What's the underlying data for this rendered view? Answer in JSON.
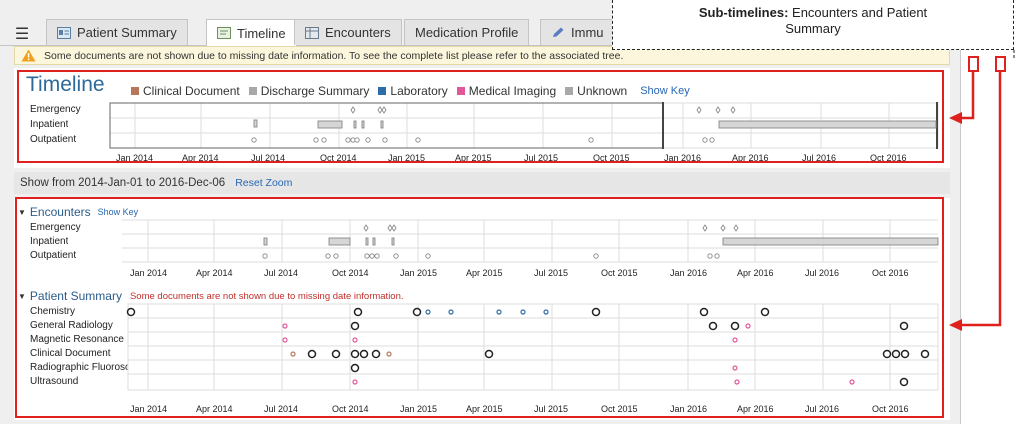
{
  "tabs": [
    {
      "label": "Patient Summary",
      "icon": "patient-summary-icon"
    },
    {
      "label": "Timeline",
      "icon": "timeline-icon",
      "active": true
    },
    {
      "label": "Encounters",
      "icon": "encounters-icon"
    },
    {
      "label": "Medication Profile",
      "icon": ""
    },
    {
      "label": "Immu",
      "icon": "pencil-icon"
    }
  ],
  "menu_icon": "hamburger-menu-icon",
  "warning": {
    "icon": "warning-triangle-icon",
    "text": "Some documents are not shown due to missing date information. To see the complete list please refer to the associated tree."
  },
  "callout": {
    "bold": "Sub-timelines:",
    "text": " Encounters and Patient",
    "text2": "Summary"
  },
  "timeline": {
    "title": "Timeline",
    "legend": [
      {
        "label": "Clinical Document",
        "color": "#b5765a"
      },
      {
        "label": "Discharge Summary",
        "color": "#a8a8a8"
      },
      {
        "label": "Laboratory",
        "color": "#2d6ca6"
      },
      {
        "label": "Medical Imaging",
        "color": "#e0579a"
      },
      {
        "label": "Unknown",
        "color": "#a8a8a8"
      }
    ],
    "show_key": "Show Key",
    "rows": [
      "Emergency",
      "Inpatient",
      "Outpatient"
    ],
    "axis": [
      "Jan 2014",
      "Apr 2014",
      "Jul 2014",
      "Oct 2014",
      "Jan 2015",
      "Apr 2015",
      "Jul 2015",
      "Oct 2015",
      "Jan 2016",
      "Apr 2016",
      "Jul 2016",
      "Oct 2016"
    ]
  },
  "zoom": {
    "text": "Show from 2014-Jan-01 to 2016-Dec-06",
    "reset": "Reset Zoom"
  },
  "encounters": {
    "title": "Encounters",
    "show_key": "Show Key",
    "rows": [
      "Emergency",
      "Inpatient",
      "Outpatient"
    ],
    "axis": [
      "Jan 2014",
      "Apr 2014",
      "Jul 2014",
      "Oct 2014",
      "Jan 2015",
      "Apr 2015",
      "Jul 2015",
      "Oct 2015",
      "Jan 2016",
      "Apr 2016",
      "Jul 2016",
      "Oct 2016"
    ]
  },
  "patient_summary": {
    "title": "Patient Summary",
    "message": "Some documents are not shown due to missing date information.",
    "rows": [
      "Chemistry",
      "General Radiology",
      "Magnetic Resonance In",
      "Clinical Document",
      "Radiographic Fluorosco",
      "Ultrasound"
    ],
    "axis": [
      "Jan 2014",
      "Apr 2014",
      "Jul 2014",
      "Oct 2014",
      "Jan 2015",
      "Apr 2015",
      "Jul 2015",
      "Oct 2015",
      "Jan 2016",
      "Apr 2016",
      "Jul 2016",
      "Oct 2016"
    ]
  }
}
